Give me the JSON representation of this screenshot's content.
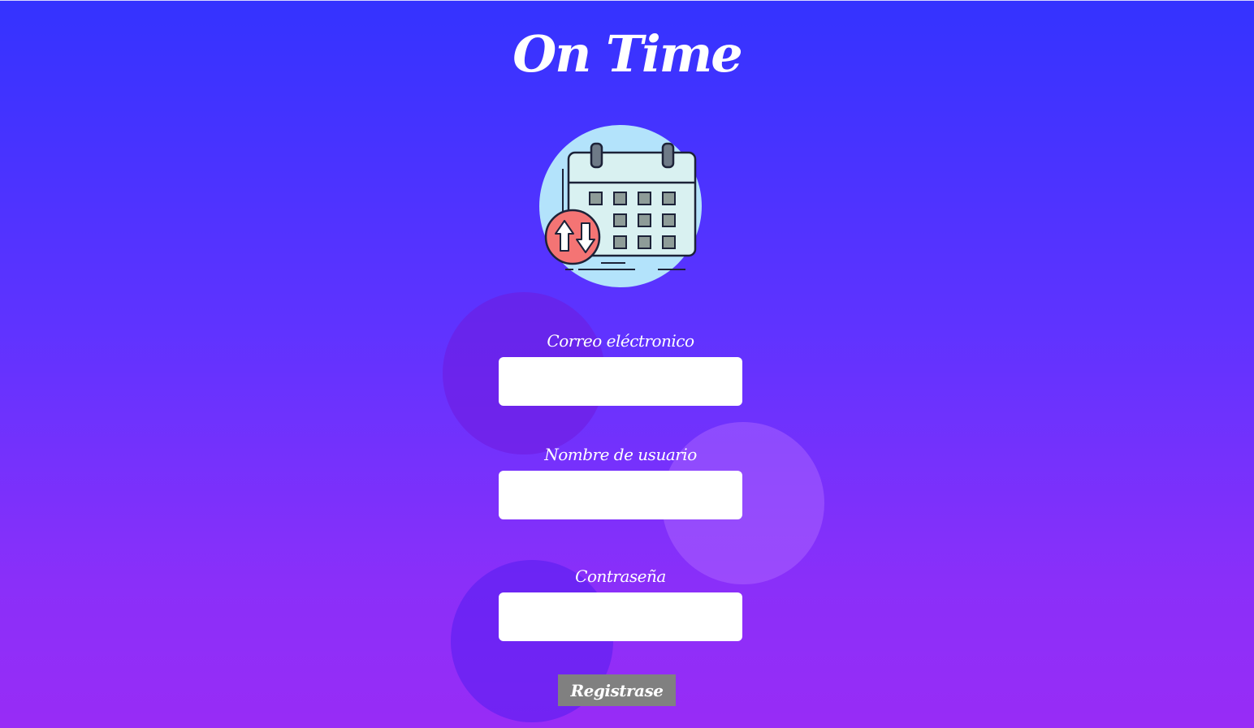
{
  "app": {
    "title": "On Time",
    "logo_icon": "calendar-sync-icon"
  },
  "form": {
    "email": {
      "label": "Correo eléctronico",
      "value": "",
      "placeholder": ""
    },
    "username": {
      "label": "Nombre de usuario",
      "value": "",
      "placeholder": ""
    },
    "password": {
      "label": "Contraseña",
      "value": "",
      "placeholder": ""
    },
    "submit_label": "Registrase"
  },
  "colors": {
    "gradient_top": "#3433ff",
    "gradient_bottom": "#982cf6",
    "button_bg": "#808080",
    "logo_circle": "#b3e3fb",
    "logo_badge": "#f47474"
  }
}
